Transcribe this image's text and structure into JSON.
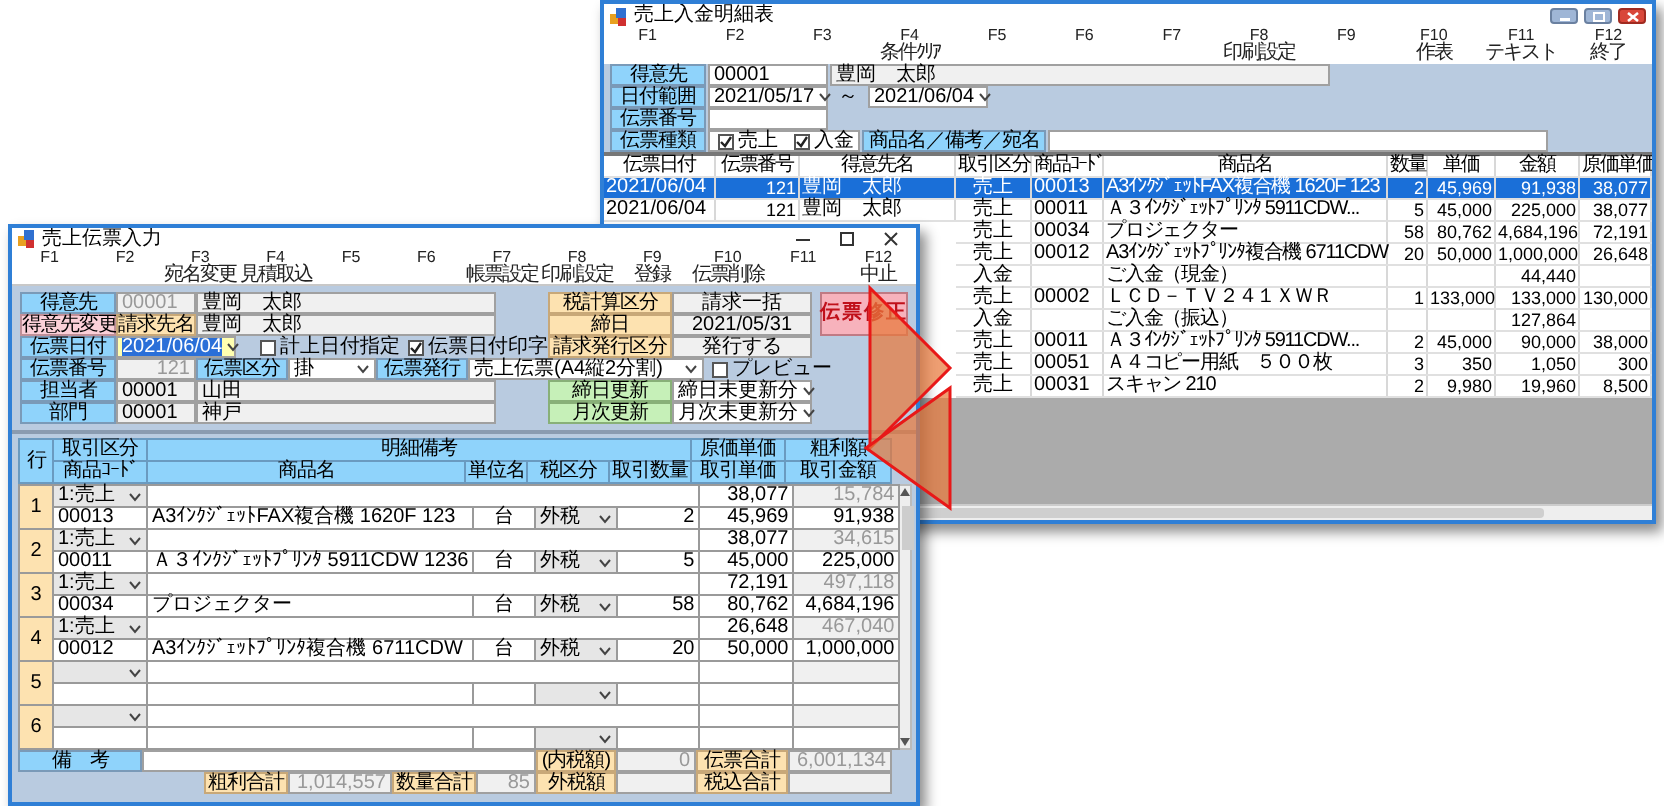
{
  "back_window": {
    "title": "売上入金明細表",
    "function_keys": [
      {
        "key": "F1"
      },
      {
        "key": "F2"
      },
      {
        "key": "F3"
      },
      {
        "key": "F4",
        "label": "条件ｸﾘｱ"
      },
      {
        "key": "F5"
      },
      {
        "key": "F6"
      },
      {
        "key": "F7"
      },
      {
        "key": "F8",
        "label": "印刷設定"
      },
      {
        "key": "F9"
      },
      {
        "key": "F10",
        "label": "作表"
      },
      {
        "key": "F11",
        "label": "テキスト"
      },
      {
        "key": "F12",
        "label": "終了"
      }
    ],
    "customer": {
      "label": "得意先",
      "code": "00001",
      "name": "豊岡　太郎"
    },
    "date_range": {
      "label": "日付範囲",
      "from": "2021/05/17",
      "separator": "～",
      "to": "2021/06/04"
    },
    "slip_number": {
      "label": "伝票番号"
    },
    "slip_kind": {
      "label": "伝票種類",
      "options": [
        {
          "label": "売上",
          "checked": true
        },
        {
          "label": "入金",
          "checked": true
        }
      ]
    },
    "keyword": {
      "label": "商品名／備考／宛名"
    },
    "table": {
      "columns": [
        "伝票日付",
        "伝票番号",
        "得意先名",
        "取引区分",
        "商品ｺｰﾄﾞ",
        "商品名",
        "数量",
        "単価",
        "金額",
        "原価単価"
      ],
      "rows": [
        {
          "selected": true,
          "date": "2021/06/04",
          "slip_no": "121",
          "customer": "豊岡　太郎",
          "type": "売上",
          "code": "00013",
          "name": "A3ｲﾝｸｼﾞｪｯﾄFAX複合機 1620F 123",
          "qty": "2",
          "price": "45,969",
          "amount": "91,938",
          "cost": "38,077"
        },
        {
          "selected": false,
          "date": "2021/06/04",
          "slip_no": "121",
          "customer": "豊岡　太郎",
          "type": "売上",
          "code": "00011",
          "name": "Ａ３ｲﾝｸｼﾞｪｯﾄﾌﾟﾘﾝﾀ 5911CDW...",
          "qty": "5",
          "price": "45,000",
          "amount": "225,000",
          "cost": "38,077"
        },
        {
          "selected": false,
          "type": "売上",
          "code": "00034",
          "name": "プロジェクター",
          "qty": "58",
          "price": "80,762",
          "amount": "4,684,196",
          "cost": "72,191"
        },
        {
          "selected": false,
          "type": "売上",
          "code": "00012",
          "name": "A3ｲﾝｸｼﾞｪｯﾄﾌﾟﾘﾝﾀ複合機 6711CDW",
          "qty": "20",
          "price": "50,000",
          "amount": "1,000,000",
          "cost": "26,648"
        },
        {
          "selected": false,
          "type": "入金",
          "name": "ご入金（現金）",
          "amount": "44,440"
        },
        {
          "selected": false,
          "type": "売上",
          "code": "00002",
          "name": "ＬＣＤ－ＴＶ２４１ＸＷＲ",
          "qty": "1",
          "price": "133,000",
          "amount": "133,000",
          "cost": "130,000"
        },
        {
          "selected": false,
          "type": "入金",
          "name": "ご入金（振込）",
          "amount": "127,864"
        },
        {
          "selected": false,
          "type": "売上",
          "code": "00011",
          "name": "Ａ３ｲﾝｸｼﾞｪｯﾄﾌﾟﾘﾝﾀ 5911CDW...",
          "qty": "2",
          "price": "45,000",
          "amount": "90,000",
          "cost": "38,000"
        },
        {
          "selected": false,
          "type": "売上",
          "code": "00051",
          "name": "Ａ４コピー用紙　５００枚",
          "qty": "3",
          "price": "350",
          "amount": "1,050",
          "cost": "300"
        },
        {
          "selected": false,
          "type": "売上",
          "code": "00031",
          "name": "スキャン 210",
          "qty": "2",
          "price": "9,980",
          "amount": "19,960",
          "cost": "8,500"
        }
      ]
    }
  },
  "front_window": {
    "title": "売上伝票入力",
    "function_keys": [
      {
        "key": "F1"
      },
      {
        "key": "F2"
      },
      {
        "key": "F3",
        "label": "宛名変更"
      },
      {
        "key": "F4",
        "label": "見積取込"
      },
      {
        "key": "F5"
      },
      {
        "key": "F6"
      },
      {
        "key": "F7",
        "label": "帳票設定"
      },
      {
        "key": "F8",
        "label": "印刷設定"
      },
      {
        "key": "F9",
        "label": "登録"
      },
      {
        "key": "F10",
        "label": "伝票削除"
      },
      {
        "key": "F11"
      },
      {
        "key": "F12",
        "label": "中止"
      }
    ],
    "customer": {
      "label": "得意先",
      "code": "00001",
      "name": "豊岡　太郎"
    },
    "change_customer_button": "得意先変更",
    "billing_name": {
      "label": "請求先名",
      "value": "豊岡　太郎"
    },
    "slip_date": {
      "label": "伝票日付",
      "value": "2021/06/04",
      "focused": true
    },
    "record_date": {
      "label": "計上日付指定",
      "checked": false
    },
    "print_date": {
      "label": "伝票日付印字",
      "checked": true
    },
    "slip_number": {
      "label": "伝票番号",
      "value": "121"
    },
    "slip_type": {
      "label": "伝票区分",
      "value": "掛"
    },
    "slip_issue": {
      "label": "伝票発行",
      "value": "売上伝票(A4縦2分割)"
    },
    "preview": {
      "label": "プレビュー",
      "checked": false
    },
    "staff": {
      "label": "担当者",
      "code": "00001",
      "name": "山田"
    },
    "department": {
      "label": "部門",
      "code": "00001",
      "name": "神戸"
    },
    "tax_calc": {
      "label": "税計算区分",
      "value": "請求一括"
    },
    "closing_date": {
      "label": "締日",
      "value": "2021/05/31"
    },
    "invoice_issue": {
      "label": "請求発行区分",
      "value": "発行する"
    },
    "status_badge": "伝票修正",
    "closing_update": {
      "label": "締日更新",
      "value": "締日未更新分"
    },
    "monthly_update": {
      "label": "月次更新",
      "value": "月次未更新分"
    },
    "grid": {
      "header_top": [
        "行",
        "取引区分",
        "明細備考",
        "原価単価",
        "粗利額"
      ],
      "header_bottom": [
        "商品ｺｰﾄﾞ",
        "商品名",
        "単位名",
        "税区分",
        "取引数量",
        "取引単価",
        "取引金額"
      ],
      "rows": [
        {
          "no": "1",
          "type": "1:売上",
          "code": "00013",
          "name": "A3ｲﾝｸｼﾞｪｯﾄFAX複合機 1620F 123",
          "unit": "台",
          "tax": "外税",
          "qty": "2",
          "cost": "38,077",
          "profit": "15,784",
          "price": "45,969",
          "amount": "91,938"
        },
        {
          "no": "2",
          "type": "1:売上",
          "code": "00011",
          "name": "Ａ３ｲﾝｸｼﾞｪｯﾄﾌﾟﾘﾝﾀ 5911CDW 1236",
          "unit": "台",
          "tax": "外税",
          "qty": "5",
          "cost": "38,077",
          "profit": "34,615",
          "price": "45,000",
          "amount": "225,000"
        },
        {
          "no": "3",
          "type": "1:売上",
          "code": "00034",
          "name": "プロジェクター",
          "unit": "台",
          "tax": "外税",
          "qty": "58",
          "cost": "72,191",
          "profit": "497,118",
          "price": "80,762",
          "amount": "4,684,196"
        },
        {
          "no": "4",
          "type": "1:売上",
          "code": "00012",
          "name": "A3ｲﾝｸｼﾞｪｯﾄﾌﾟﾘﾝﾀ複合機 6711CDW",
          "unit": "台",
          "tax": "外税",
          "qty": "20",
          "cost": "26,648",
          "profit": "467,040",
          "price": "50,000",
          "amount": "1,000,000"
        },
        {
          "no": "5"
        },
        {
          "no": "6"
        }
      ]
    },
    "footer": {
      "remarks_label": "備　考",
      "inner_tax_label": "(内税額)",
      "inner_tax": "0",
      "slip_total_label": "伝票合計",
      "slip_total": "6,001,134",
      "gross_profit_label": "粗利合計",
      "gross_profit": "1,014,557",
      "quantity_total_label": "数量合計",
      "quantity_total": "85",
      "outer_tax_label": "外税額",
      "tax_included_label": "税込合計"
    }
  }
}
